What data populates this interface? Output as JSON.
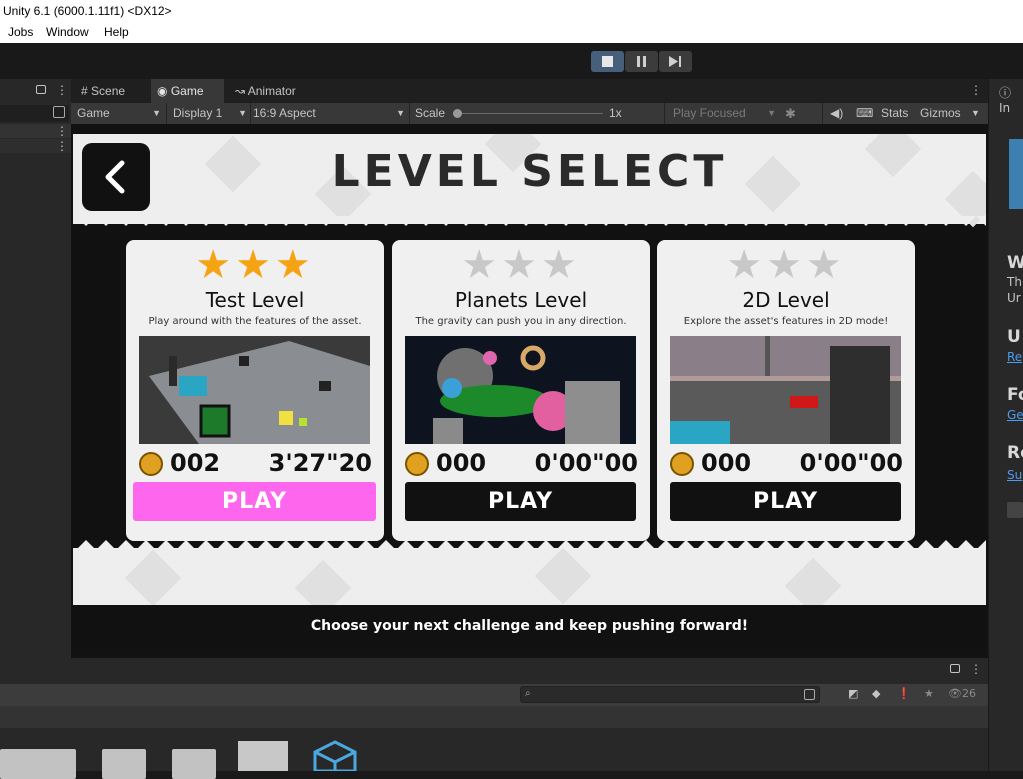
{
  "window": {
    "title": "Unity 6.1 (6000.1.11f1) <DX12>"
  },
  "menu": {
    "items": [
      "Jobs",
      "Window",
      "Help"
    ]
  },
  "tabs": {
    "scene": "Scene",
    "game": "Game",
    "animator": "Animator"
  },
  "game_toolbar": {
    "mode": "Game",
    "display": "Display 1",
    "aspect": "16:9 Aspect",
    "scale_label": "Scale",
    "scale_value": "1x",
    "play_focused": "Play Focused",
    "stats": "Stats",
    "gizmos": "Gizmos"
  },
  "level_select": {
    "title": "LEVEL SELECT",
    "levels": [
      {
        "name": "Test Level",
        "description": "Play around with the features of the asset.",
        "stars_earned": 3,
        "coins": "002",
        "time": "3'27\"20",
        "play": "PLAY"
      },
      {
        "name": "Planets Level",
        "description": "The gravity can push you in any direction.",
        "stars_earned": 0,
        "coins": "000",
        "time": "0'00\"00",
        "play": "PLAY"
      },
      {
        "name": "2D Level",
        "description": "Explore the asset's features in 2D mode!",
        "stars_earned": 0,
        "coins": "000",
        "time": "0'00\"00",
        "play": "PLAY"
      }
    ],
    "subtitle": "Choose your next challenge and keep pushing forward!"
  },
  "inspector": {
    "tab": "In",
    "fragments": [
      "W",
      "Th",
      "Ur",
      "U",
      "Re",
      "Fo",
      "Ge",
      "Re",
      "Su"
    ]
  },
  "project": {
    "hidden_count": "26"
  },
  "colors": {
    "accent_play": "#ff66ee",
    "star_gold": "#f6a313",
    "star_empty": "#c8c8c8",
    "coin": "#e0a020"
  }
}
